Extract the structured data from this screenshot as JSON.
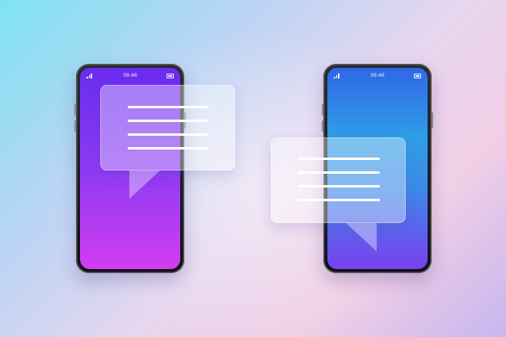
{
  "colors": {
    "left_screen": [
      "#6a2cf0",
      "#d13df0"
    ],
    "right_screen": [
      "#2f68e6",
      "#7a3ff0"
    ],
    "bubble": "#ffffff",
    "background": [
      "#7fe3f1",
      "#f1cfe6"
    ]
  },
  "phones": {
    "left": {
      "status_time": "09:46",
      "signal_icon": "signal-icon",
      "battery_icon": "battery-icon"
    },
    "right": {
      "status_time": "09:46",
      "signal_icon": "signal-icon",
      "battery_icon": "battery-icon"
    }
  },
  "bubbles": {
    "left": {
      "text_line_count": 4
    },
    "right": {
      "text_line_count": 4
    }
  }
}
